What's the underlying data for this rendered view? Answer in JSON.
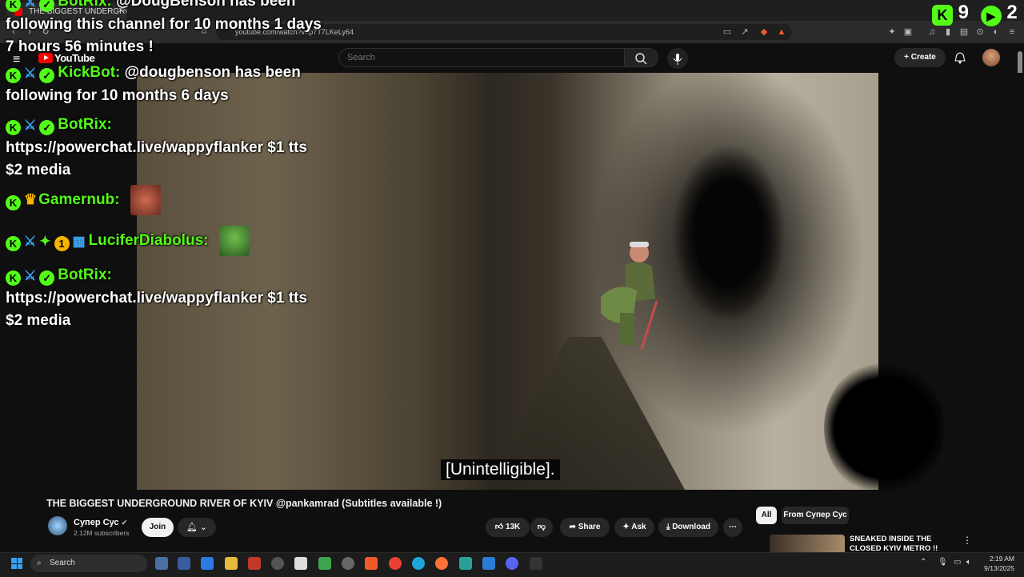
{
  "browser": {
    "tab_title": "THE BIGGEST UNDERGROUND",
    "tab_close": "×",
    "url": "youtube.com/watch?v=p7T7LKeLy64"
  },
  "youtube": {
    "logo_text": "YouTube",
    "search_placeholder": "Search",
    "create_label": "Create"
  },
  "overlay": {
    "top_count_a": "9",
    "top_count_b": "2",
    "chat": [
      {
        "user": "BotRix:",
        "text": "@DougBenson has been following this channel for 10 months 1 days 7 hours 56 minutes !"
      },
      {
        "user": "KickBot:",
        "text": "@dougbenson has been following for 10 months 6 days"
      },
      {
        "user": "BotRix:",
        "text": "https://powerchat.live/wappyflanker $1 tts $2 media"
      },
      {
        "user": "Gamernub:",
        "text": ""
      },
      {
        "user": "LuciferDiabolus:",
        "text": ""
      },
      {
        "user": "BotRix:",
        "text": "https://powerchat.live/wappyflanker $1 tts $2 media"
      }
    ]
  },
  "video": {
    "subtitle": "[Unintelligible]."
  },
  "details": {
    "title": "THE BIGGEST UNDERGROUND RIVER OF KYIV @pankamrad (Subtitles available !)",
    "channel_name": "Супер Сус",
    "subscribers": "2.12M subscribers",
    "join_label": "Join",
    "likes": "13K",
    "share_label": "Share",
    "ask_label": "Ask",
    "download_label": "Download"
  },
  "sidebar": {
    "chips": [
      "All",
      "From Супер Сус"
    ],
    "rec_title": "SNEAKED INSIDE THE CLOSED KYIV METRO !!"
  },
  "taskbar": {
    "search_label": "Search",
    "time": "2:19 AM",
    "date": "9/13/2025"
  }
}
